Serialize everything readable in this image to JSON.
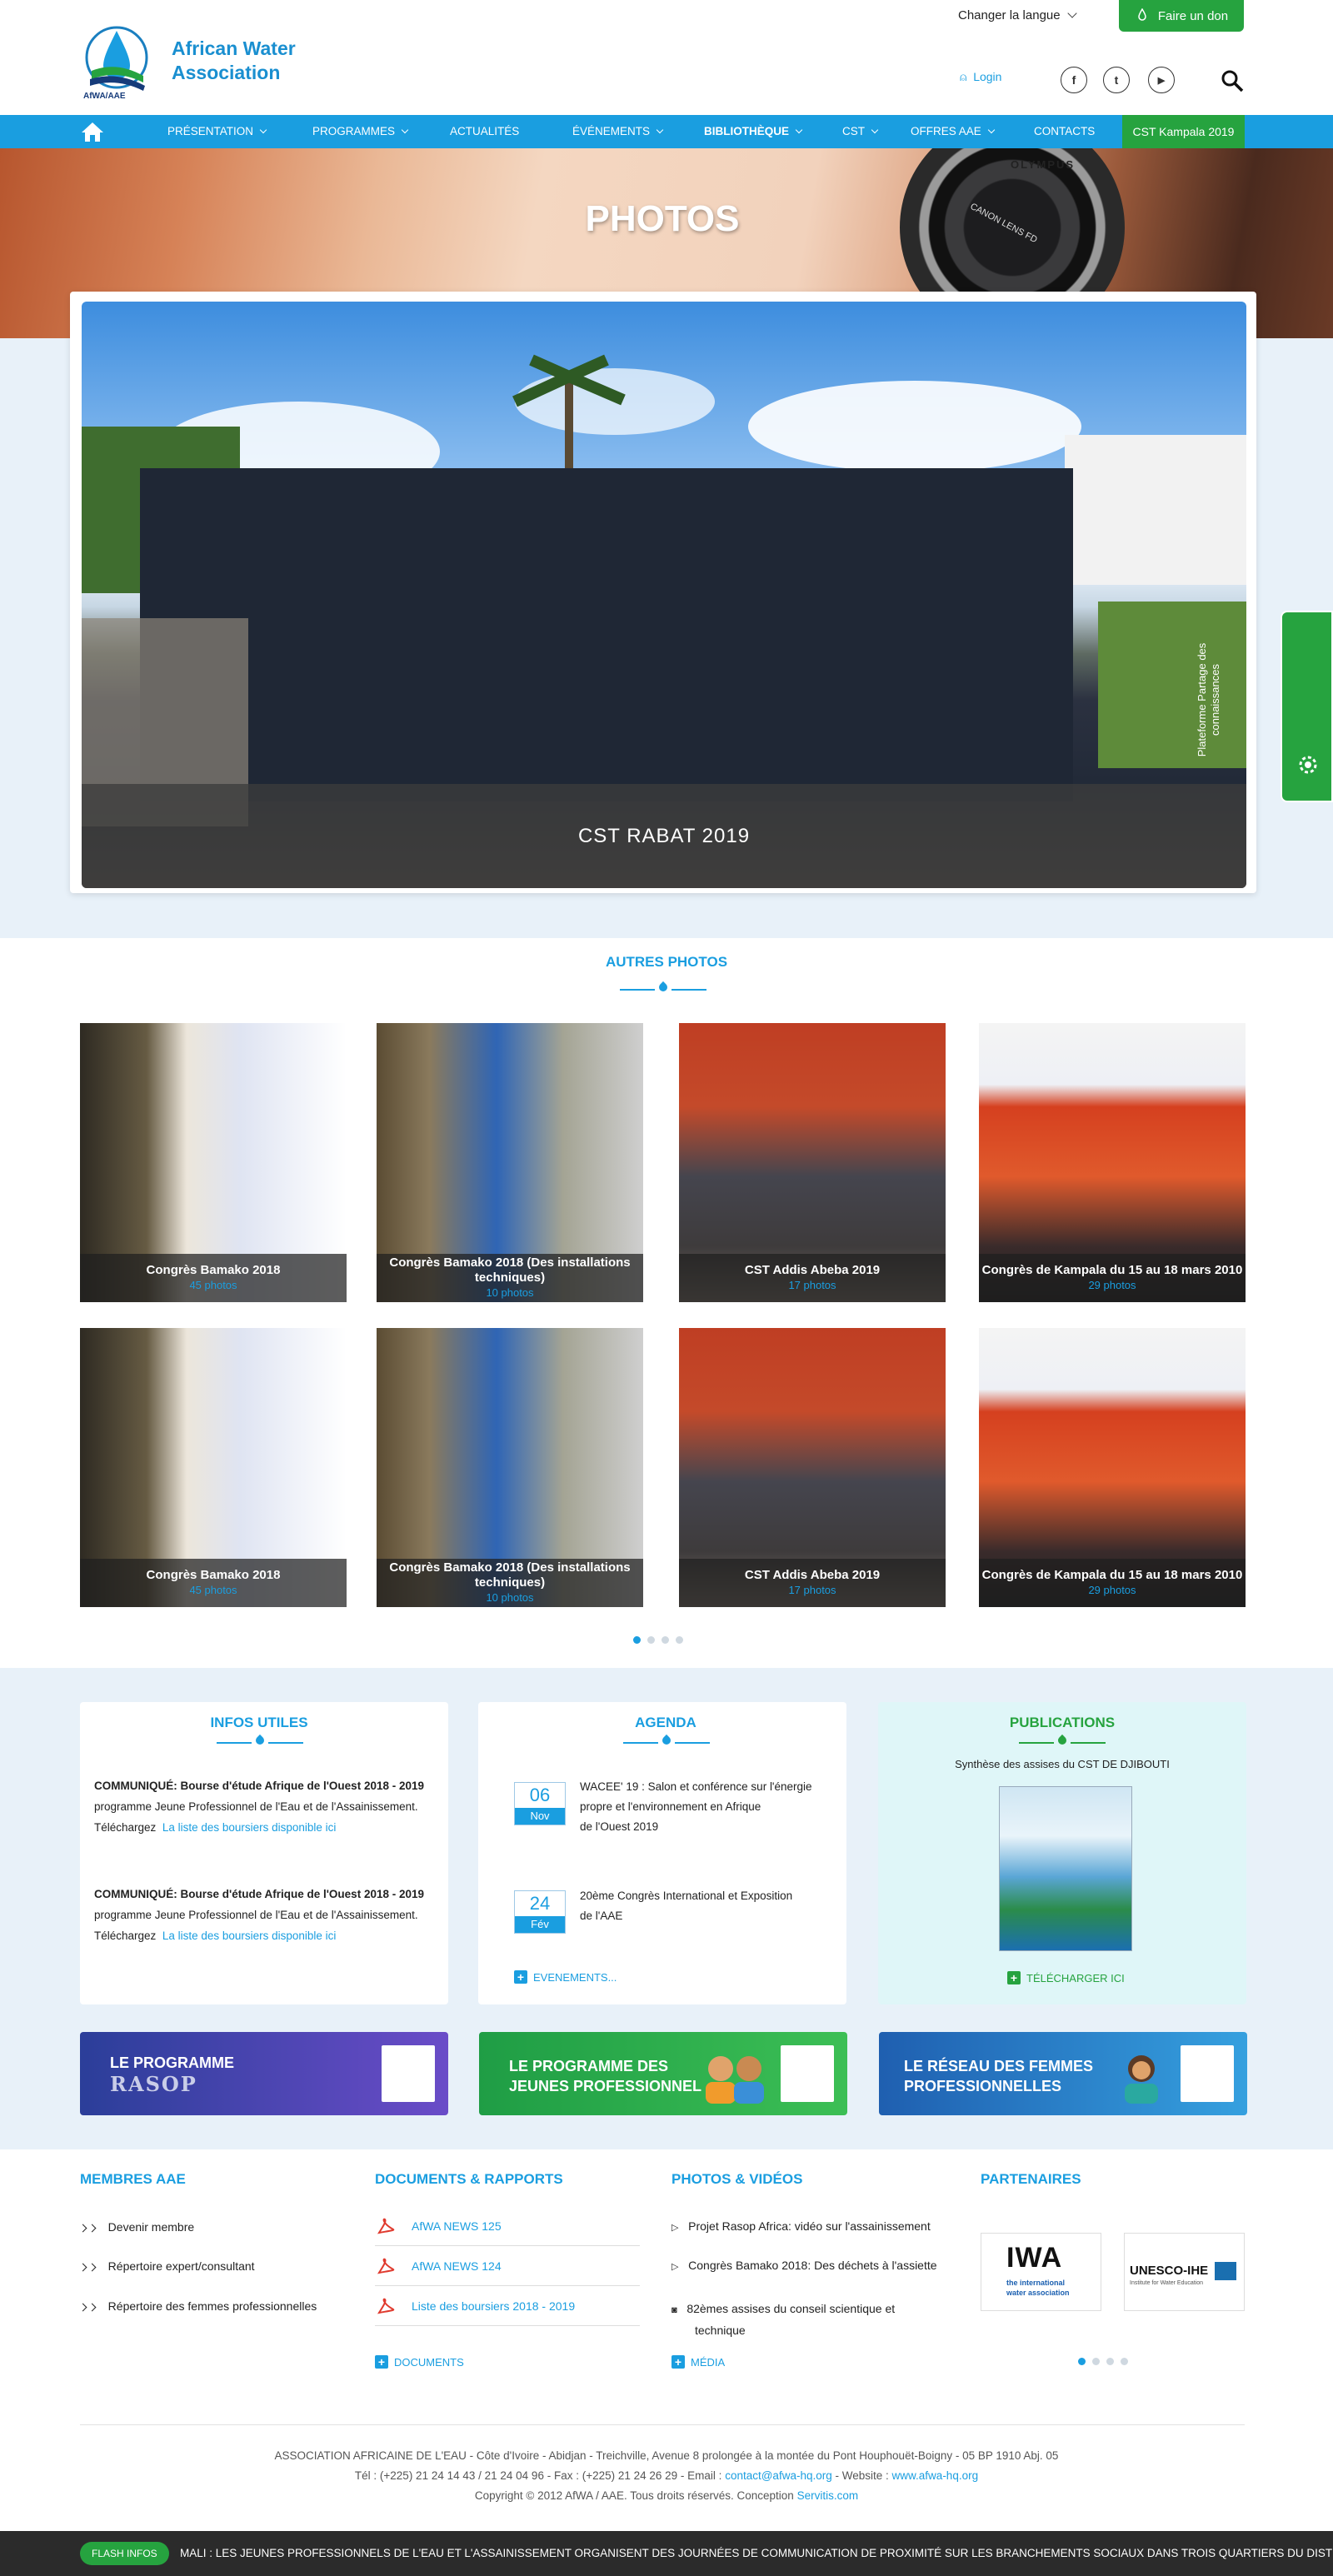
{
  "header": {
    "logo_text_line1": "African Water",
    "logo_text_line2": "Association",
    "logo_caption": "AfWA/AAE",
    "language_label": "Changer la langue",
    "donate_label": "Faire un don",
    "login_label": "Login",
    "social": [
      {
        "icon": "facebook-icon",
        "glyph": "f"
      },
      {
        "icon": "twitter-icon",
        "glyph": "t"
      },
      {
        "icon": "youtube-icon",
        "glyph": "▶"
      }
    ]
  },
  "nav": {
    "items": [
      {
        "label": "Présentation",
        "dropdown": true
      },
      {
        "label": "Programmes",
        "dropdown": true
      },
      {
        "label": "Actualités",
        "dropdown": false
      },
      {
        "label": "Événements",
        "dropdown": true
      },
      {
        "label": "Bibliothèque",
        "dropdown": true
      },
      {
        "label": "CST",
        "dropdown": true
      },
      {
        "label": "Offres AAE",
        "dropdown": true
      },
      {
        "label": "Contacts",
        "dropdown": false
      }
    ],
    "highlight_label": "CST Kampala 2019"
  },
  "hero": {
    "title": "PHOTOS",
    "camera_brand": "OLYMPUS",
    "lens_text": "CANON LENS FD"
  },
  "slider": {
    "caption": "CST RABAT 2019"
  },
  "side_tab": {
    "label": "Plateforme Partage des connaissances"
  },
  "gallery": {
    "title": "AUTRES PHOTOS",
    "rows": [
      [
        {
          "title": "Congrès Bamako 2018",
          "count": "45 photos"
        },
        {
          "title": "Congrès Bamako 2018 (Des installations techniques)",
          "count": "10 photos"
        },
        {
          "title": "CST Addis Abeba 2019",
          "count": "17 photos"
        },
        {
          "title": "Congrès de Kampala du 15 au 18 mars 2010",
          "count": "29 photos"
        }
      ],
      [
        {
          "title": "Congrès Bamako 2018",
          "count": "45 photos"
        },
        {
          "title": "Congrès Bamako 2018 (Des installations techniques)",
          "count": "10 photos"
        },
        {
          "title": "CST Addis Abeba 2019",
          "count": "17 photos"
        },
        {
          "title": "Congrès de Kampala du 15 au 18 mars 2010",
          "count": "29 photos"
        }
      ]
    ],
    "dots": 4,
    "active_dot": 0
  },
  "infos": {
    "title": "INFOS UTILES",
    "items": [
      {
        "heading": "COMMUNIQUÉ: Bourse d'étude Afrique de l'Ouest 2018 - 2019",
        "body": "programme Jeune Professionnel de l'Eau et de l'Assainissement.",
        "prefix": "Téléchargez",
        "link": "La liste des boursiers disponible ici"
      },
      {
        "heading": "COMMUNIQUÉ: Bourse d'étude Afrique de l'Ouest 2018 - 2019",
        "body": "programme Jeune Professionnel de l'Eau et de l'Assainissement.",
        "prefix": "Téléchargez",
        "link": "La liste des boursiers disponible ici"
      }
    ]
  },
  "agenda": {
    "title": "AGENDA",
    "items": [
      {
        "day": "06",
        "month": "Nov",
        "text1": "WACEE' 19 : Salon et conférence sur l'énergie",
        "text2": "propre et l'environnement en Afrique",
        "text3": "de l'Ouest 2019"
      },
      {
        "day": "24",
        "month": "Fév",
        "text1": "20ème Congrès International et Exposition",
        "text2": "de l'AAE",
        "text3": ""
      }
    ],
    "more_label": "EVENEMENTS..."
  },
  "publications": {
    "title": "PUBLICATIONS",
    "subtitle": "Synthèse des assises du CST DE DJIBOUTI",
    "download_label": "TÉLÉCHARGER ICI"
  },
  "banners": [
    {
      "line1": "LE PROGRAMME",
      "line2": "RASOP",
      "color_from": "#2b3e99",
      "color_to": "#6a4cc8"
    },
    {
      "line1": "LE PROGRAMME DES",
      "line2": "JEUNES PROFESSIONNEL",
      "color_from": "#1f9d45",
      "color_to": "#3cbf55"
    },
    {
      "line1": "LE RÉSEAU DES FEMMES",
      "line2": "PROFESSIONNELLES",
      "color_from": "#1f5fb0",
      "color_to": "#35a0df"
    }
  ],
  "footer": {
    "members": {
      "title": "MEMBRES AAE",
      "links": [
        "Devenir membre",
        "Répertoire expert/consultant",
        "Répertoire des femmes professionnelles"
      ]
    },
    "documents": {
      "title": "DOCUMENTS & RAPPORTS",
      "links": [
        "AfWA NEWS 125",
        "AfWA NEWS 124",
        "Liste des boursiers 2018 - 2019"
      ],
      "more_label": "DOCUMENTS"
    },
    "media": {
      "title": "PHOTOS & VIDÉOS",
      "links": [
        "Projet Rasop Africa: vidéo sur l'assainissement",
        "Congrès Bamako 2018: Des déchets à l'assiette",
        "82èmes assises du conseil scientique et",
        "technique"
      ],
      "more_label": "MÉDIA"
    },
    "partners": {
      "title": "PARTENAIRES",
      "iwa_logo": "IWA",
      "iwa_sub1": "the international",
      "iwa_sub2": "water association",
      "unesco_logo": "UNESCO-IHE",
      "unesco_sub": "Institute for Water Education"
    },
    "address": "ASSOCIATION AFRICAINE DE L'EAU - Côte d'Ivoire - Abidjan - Treichville, Avenue 8 prolongée à la montée du Pont Houphouët-Boigny - 05 BP 1910 Abj. 05",
    "phone": "Tél : (+225) 21 24 14 43 / 21 24 04 96 - Fax : (+225) 21 24 26 29 - Email :",
    "email": "contact@afwa-hq.org",
    "website_prefix": "- Website :",
    "website": "www.afwa-hq.org",
    "copyright": "Copyright © 2012 AfWA / AAE. Tous droits réservés. Conception",
    "designer": "Servitis.com"
  },
  "flash": {
    "label": "FLASH INFOS",
    "message": "MALI : LES JEUNES PROFESSIONNELS DE L'EAU ET L'ASSAINISSEMENT ORGANISENT DES JOURNÉES DE COMMUNICATION DE PROXIMITÉ SUR LES  BRANCHEMENTS SOCIAUX DANS TROIS QUARTIERS DU DISTRICT DE"
  },
  "colors": {
    "brand_blue": "#1a9ee0",
    "brand_green": "#26a33f"
  }
}
